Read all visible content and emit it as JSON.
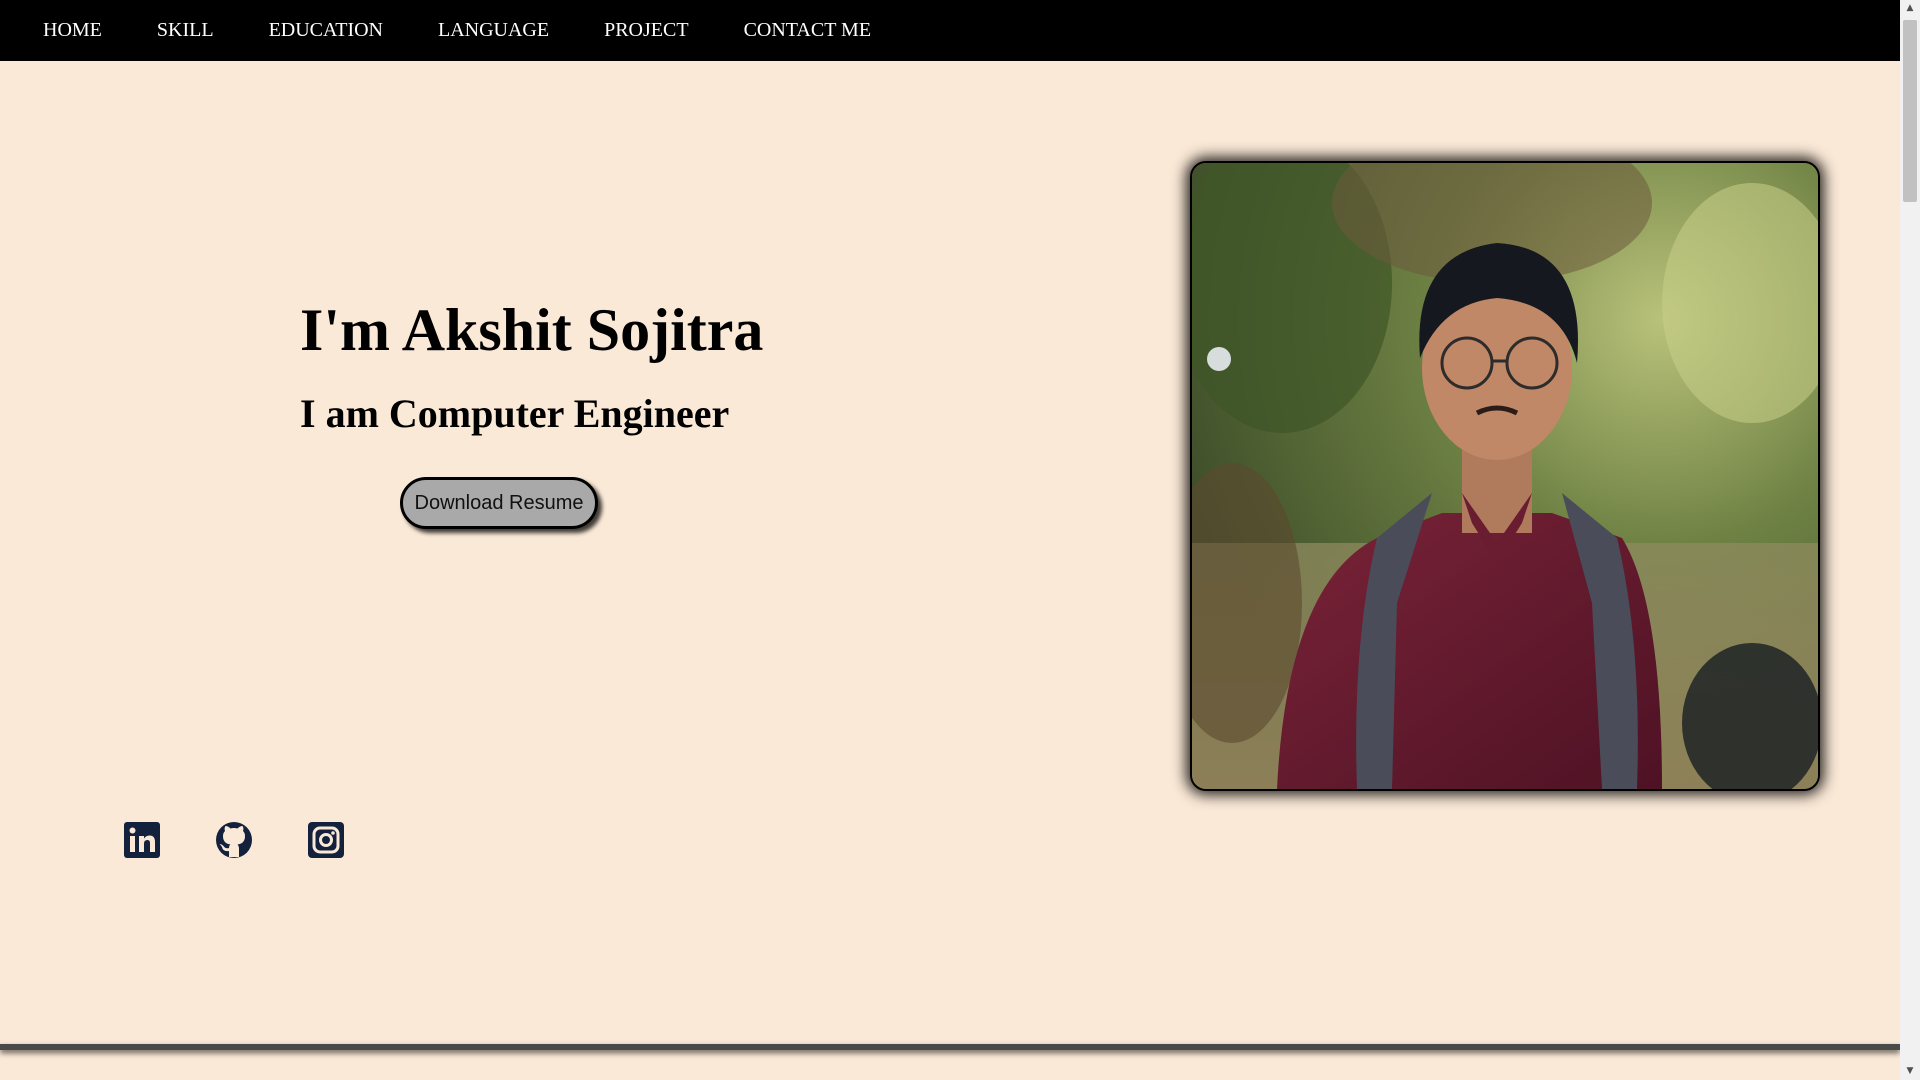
{
  "nav": {
    "items": [
      {
        "label": "HOME"
      },
      {
        "label": "SKILL"
      },
      {
        "label": "EDUCATION"
      },
      {
        "label": "LANGUAGE"
      },
      {
        "label": "PROJECT"
      },
      {
        "label": "CONTACT ME"
      }
    ]
  },
  "hero": {
    "title": "I'm Akshit Sojitra",
    "subtitle": "I am Computer Engineer",
    "resume_button": "Download Resume"
  },
  "photo": {
    "subject": "profile-photo"
  },
  "social": {
    "icons": [
      "linkedin-icon",
      "github-icon",
      "instagram-icon"
    ],
    "color": "#14213d"
  },
  "colors": {
    "page_bg": "#fbe9d7",
    "nav_bg": "#000000",
    "nav_text": "#ffffff",
    "button_bg": "#a9a9a9"
  },
  "scrollbar": {
    "up_glyph": "▲",
    "down_glyph": "▼"
  }
}
